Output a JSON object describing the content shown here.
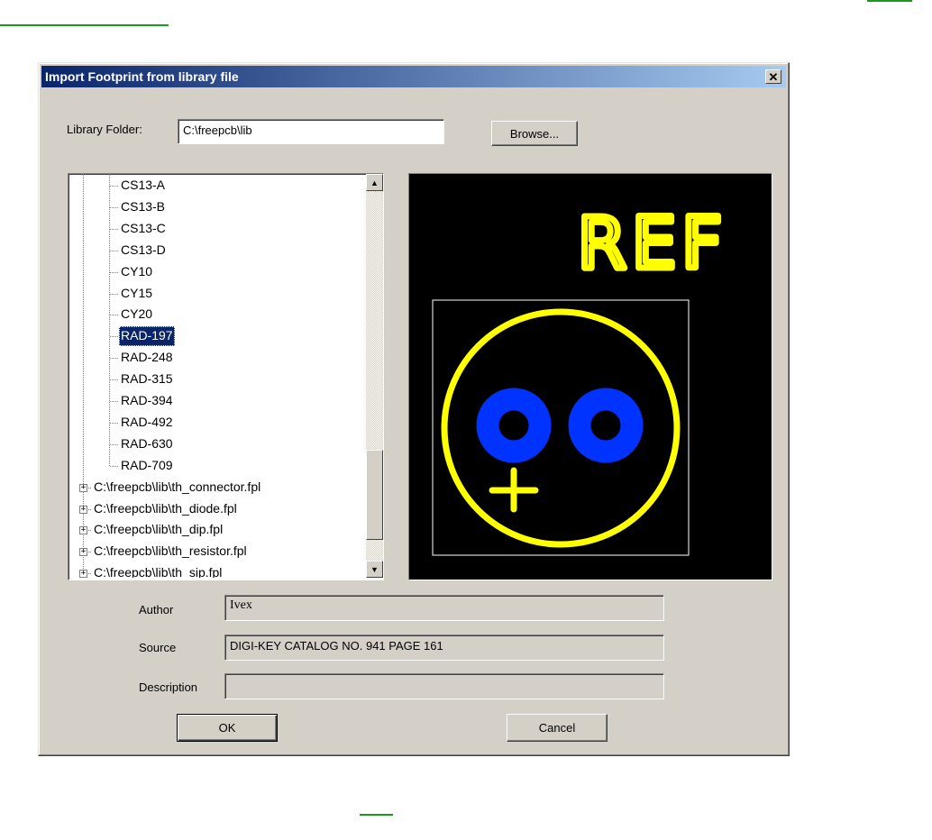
{
  "dialog": {
    "title": "Import Footprint from library file",
    "close_glyph": "✕"
  },
  "library_folder": {
    "label": "Library Folder:",
    "value": "C:\\freepcb\\lib",
    "browse_label": "Browse..."
  },
  "tree": {
    "children": [
      "CS13-A",
      "CS13-B",
      "CS13-C",
      "CS13-D",
      "CY10",
      "CY15",
      "CY20",
      "RAD-197",
      "RAD-248",
      "RAD-315",
      "RAD-394",
      "RAD-492",
      "RAD-630",
      "RAD-709"
    ],
    "selected": "RAD-197",
    "files": [
      "C:\\freepcb\\lib\\th_connector.fpl",
      "C:\\freepcb\\lib\\th_diode.fpl",
      "C:\\freepcb\\lib\\th_dip.fpl",
      "C:\\freepcb\\lib\\th_resistor.fpl",
      "C:\\freepcb\\lib\\th_sip.fpl"
    ],
    "expander_glyph": "+",
    "scroll_up_glyph": "▲",
    "scroll_down_glyph": "▼"
  },
  "preview": {
    "ref_text": "REF",
    "colors": {
      "background": "#000000",
      "silk": "#ffff00",
      "pad": "#0033ff",
      "outline": "#ffffff"
    }
  },
  "fields": {
    "author_label": "Author",
    "author_value": "Ivex",
    "source_label": "Source",
    "source_value": "DIGI-KEY CATALOG NO. 941 PAGE 161",
    "description_label": "Description",
    "description_value": ""
  },
  "buttons": {
    "ok": "OK",
    "cancel": "Cancel"
  }
}
